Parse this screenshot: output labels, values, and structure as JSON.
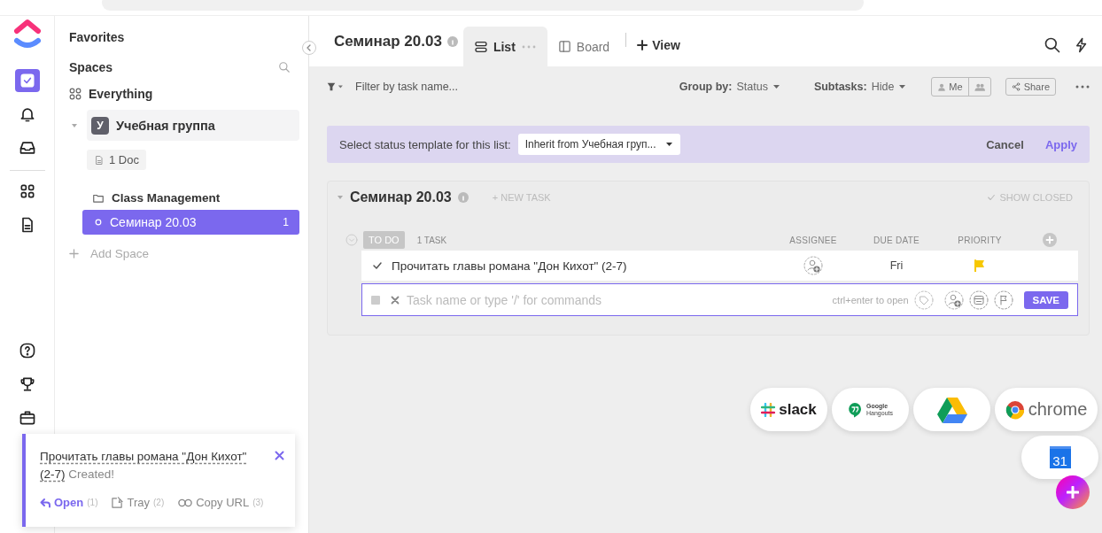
{
  "rail": {
    "items": [
      {
        "kind": "tasks",
        "selected": true
      },
      {
        "kind": "bell",
        "selected": false
      },
      {
        "kind": "inbox",
        "selected": false
      },
      {
        "kind": "apps",
        "selected": false
      },
      {
        "kind": "doc",
        "selected": false
      },
      {
        "kind": "help",
        "selected": false
      },
      {
        "kind": "trophy",
        "selected": false
      },
      {
        "kind": "briefcase",
        "selected": false
      }
    ]
  },
  "sidebar": {
    "favorites": "Favorites",
    "spaces": "Spaces",
    "everything": "Everything",
    "space": {
      "badge": "У",
      "name": "Учебная группа",
      "expanded": true
    },
    "doc": "1 Doc",
    "folder": "Class Management",
    "lists": [
      {
        "name": "Семинар 20.03",
        "count": "1",
        "selected": true
      }
    ],
    "add_space": "Add Space"
  },
  "header": {
    "title": "Семинар 20.03",
    "tabs": [
      {
        "kind": "list",
        "label": "List",
        "selected": true
      },
      {
        "kind": "board",
        "label": "Board",
        "selected": false
      }
    ],
    "add_view": "View"
  },
  "toolbar": {
    "filter_placeholder": "Filter by task name...",
    "group_by": {
      "label": "Group by:",
      "value": "Status"
    },
    "subtasks": {
      "label": "Subtasks:",
      "value": "Hide"
    },
    "me": "Me",
    "share": "Share"
  },
  "banner": {
    "label": "Select status template for this list:",
    "template": "Inherit from Учебная груп...",
    "cancel": "Cancel",
    "apply": "Apply"
  },
  "list": {
    "title": "Семинар 20.03",
    "new_task": "+ NEW TASK",
    "show_closed": "SHOW CLOSED",
    "groups": [
      {
        "status": "TO DO",
        "count": "1 TASK",
        "columns": [
          "ASSIGNEE",
          "DUE DATE",
          "PRIORITY"
        ],
        "tasks": [
          {
            "name": "Прочитать главы романа \"Дон Кихот\" (2-7)",
            "due": "Fri",
            "color": "#f7c800"
          }
        ],
        "new_row": {
          "placeholder": "Task name or type '/' for commands",
          "hint": "ctrl+enter to open",
          "save": "SAVE"
        }
      }
    ]
  },
  "integrations": [
    {
      "kind": "slack",
      "label": "slack"
    },
    {
      "kind": "hangouts",
      "lines": [
        "Google",
        "Hangouts"
      ]
    },
    {
      "kind": "drive"
    },
    {
      "kind": "chrome",
      "label": "chrome"
    },
    {
      "kind": "calendar",
      "label": "31"
    }
  ],
  "toast": {
    "task": "Прочитать главы романа \"Дон Кихот\" (2-7)",
    "message": "Created!",
    "actions": [
      {
        "kind": "open",
        "label": "Open",
        "key": "(1)"
      },
      {
        "kind": "tray",
        "label": "Tray",
        "key": "(2)"
      },
      {
        "kind": "copy",
        "label": "Copy URL",
        "key": "(3)"
      }
    ]
  }
}
